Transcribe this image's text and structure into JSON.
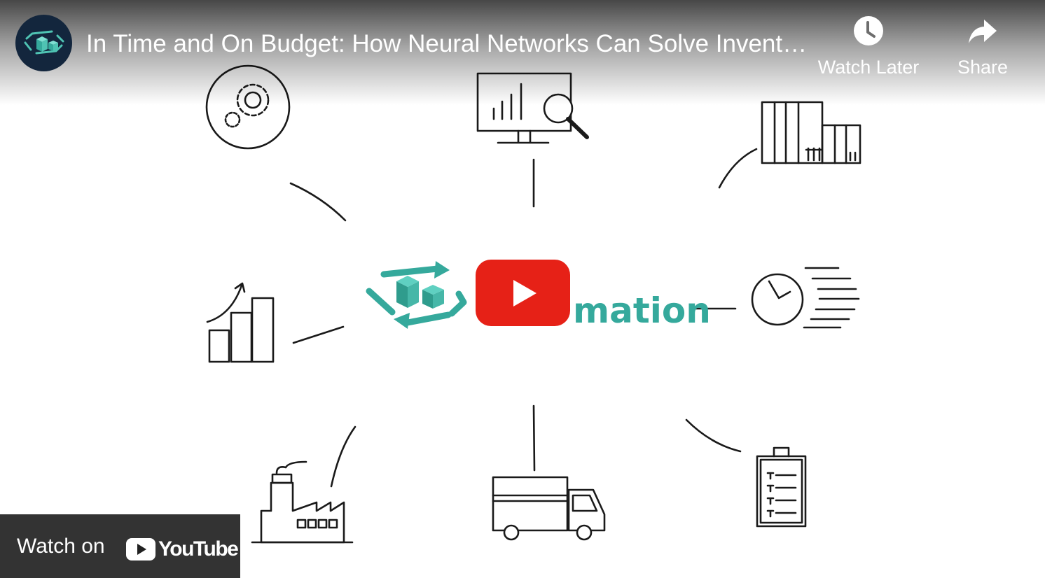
{
  "player": {
    "title": "In Time and On Budget: How Neural Networks Can Solve Inventory Management Challenges",
    "channel_avatar_icon": "boxes-cycle-logo-icon",
    "watch_later_label": "Watch Later",
    "share_label": "Share",
    "play_icon": "play-icon"
  },
  "watch_on": {
    "label": "Watch on",
    "brand": "YouTube"
  },
  "thumbnail": {
    "center_word": "mation",
    "accent_color": "#35a99c",
    "play_red": "#e62117",
    "icons": [
      "gears-icon",
      "monitor-analytics-icon",
      "warehouse-shelves-icon",
      "growth-chart-icon",
      "clock-speed-icon",
      "factory-icon",
      "delivery-truck-icon",
      "checklist-clipboard-icon"
    ]
  }
}
